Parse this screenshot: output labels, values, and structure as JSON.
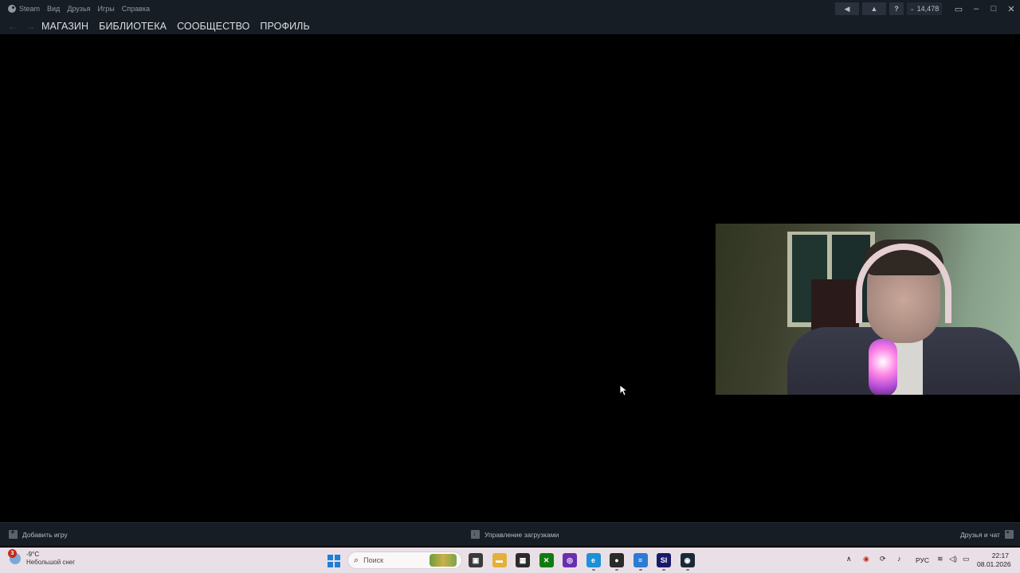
{
  "steam": {
    "menu": {
      "app_name": "Steam",
      "items": [
        "Вид",
        "Друзья",
        "Игры",
        "Справка"
      ]
    },
    "titlebar": {
      "help_label": "?",
      "wallet": "14,478"
    },
    "nav": {
      "links": [
        "МАГАЗИН",
        "БИБЛИОТЕКА",
        "СООБЩЕСТВО",
        "ПРОФИЛЬ"
      ]
    },
    "bottom": {
      "add_game": "Добавить игру",
      "downloads": "Управление загрузками",
      "friends": "Друзья и чат"
    }
  },
  "taskbar": {
    "weather": {
      "badge": "3",
      "temperature": "-9°C",
      "condition": "Небольшой снег"
    },
    "search_placeholder": "Поиск",
    "apps": [
      {
        "name": "task-view-icon",
        "color": "#3a3a3a",
        "glyph": "▣"
      },
      {
        "name": "file-explorer-icon",
        "color": "#e3b13a",
        "glyph": "▬"
      },
      {
        "name": "media-app-icon",
        "color": "#2b2b2b",
        "glyph": "▦"
      },
      {
        "name": "xbox-icon",
        "color": "#107c10",
        "glyph": "✕"
      },
      {
        "name": "purple-app-icon",
        "color": "#6a2fb0",
        "glyph": "◎"
      },
      {
        "name": "edge-icon",
        "color": "#1f8fd6",
        "glyph": "e"
      },
      {
        "name": "obs-icon",
        "color": "#2a2a2a",
        "glyph": "●"
      },
      {
        "name": "notes-app-icon",
        "color": "#2b7bd6",
        "glyph": "≡"
      },
      {
        "name": "si-app-icon",
        "color": "#1a1a6a",
        "glyph": "SI"
      },
      {
        "name": "steam-taskbar-icon",
        "color": "#1b2838",
        "glyph": "◉"
      }
    ],
    "tray": {
      "language": "РУС"
    },
    "clock": {
      "time": "22:17",
      "date": "08.01.2026"
    }
  }
}
